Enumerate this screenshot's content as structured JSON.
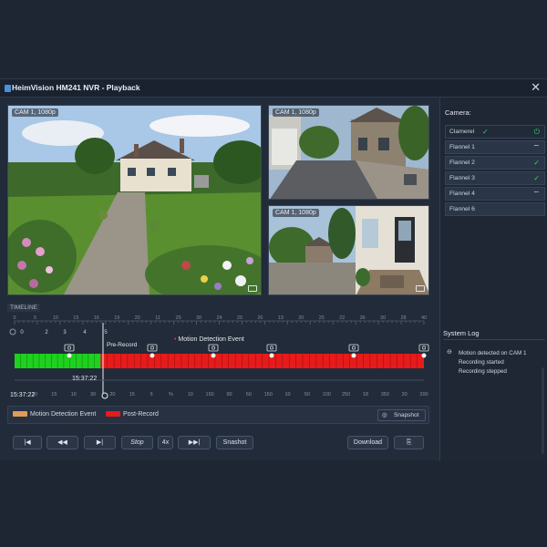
{
  "window": {
    "title": "HeimVision HM241 NVR - Playback"
  },
  "cameras": [
    {
      "label": "CAM 1, 1080p"
    },
    {
      "label": "CAM 1, 1080p"
    },
    {
      "label": "CAM 1, 1080p"
    }
  ],
  "timeline": {
    "label": "TIMELINE",
    "top_ticks": [
      "0",
      "5",
      "10",
      "15",
      "16",
      "19",
      "20",
      "11",
      "25",
      "30",
      "24",
      "20",
      "26",
      "19",
      "20",
      "25",
      "22",
      "36",
      "30",
      "28",
      "40"
    ],
    "row_numbers": [
      "0",
      "2",
      "3",
      "4",
      "5"
    ],
    "annotations": {
      "pre_record": "Pre-Record",
      "motion_event": "Motion Detection Event"
    },
    "cursor_time": "15:37:22",
    "start_time": "15:37:22",
    "bottom_ticks": [
      "10",
      "15",
      "10",
      "30",
      "20",
      "15",
      "6",
      "%",
      "10",
      "150",
      "90",
      "60",
      "150",
      "10",
      "50",
      "100",
      "250",
      "18",
      "350",
      "20",
      "200"
    ],
    "recording": {
      "green_fraction": 0.21,
      "status_colors": {
        "continuous": "#1fd11f",
        "post_record": "#e61b1b",
        "motion": "#e09a5a"
      }
    }
  },
  "legend": {
    "motion": "Motion Detection Event",
    "post_record": "Post-Record",
    "snapshot": "Snapshot"
  },
  "controls": {
    "skip_back": "|◀",
    "rewind": "◀◀",
    "play": "▶|",
    "stop": "Stop",
    "speed": "4x",
    "fast_forward": "▶▶|",
    "snapshot": "Snashot",
    "download": "Download"
  },
  "sidebar": {
    "camera_heading": "Camera:",
    "cameras": [
      {
        "label": "Clamerel",
        "icon": "check-power"
      },
      {
        "label": "Flannel 1",
        "icon": "wifi"
      },
      {
        "label": "Flannel 2",
        "icon": "check"
      },
      {
        "label": "Flannel 3",
        "icon": "check"
      },
      {
        "label": "Flannel 4",
        "icon": "wifi"
      },
      {
        "label": "Flannel 6",
        "icon": "none"
      }
    ],
    "log_heading": "System Log",
    "log": [
      "Motion detected on CAM 1",
      "Recording started",
      "Recording stepped"
    ]
  }
}
